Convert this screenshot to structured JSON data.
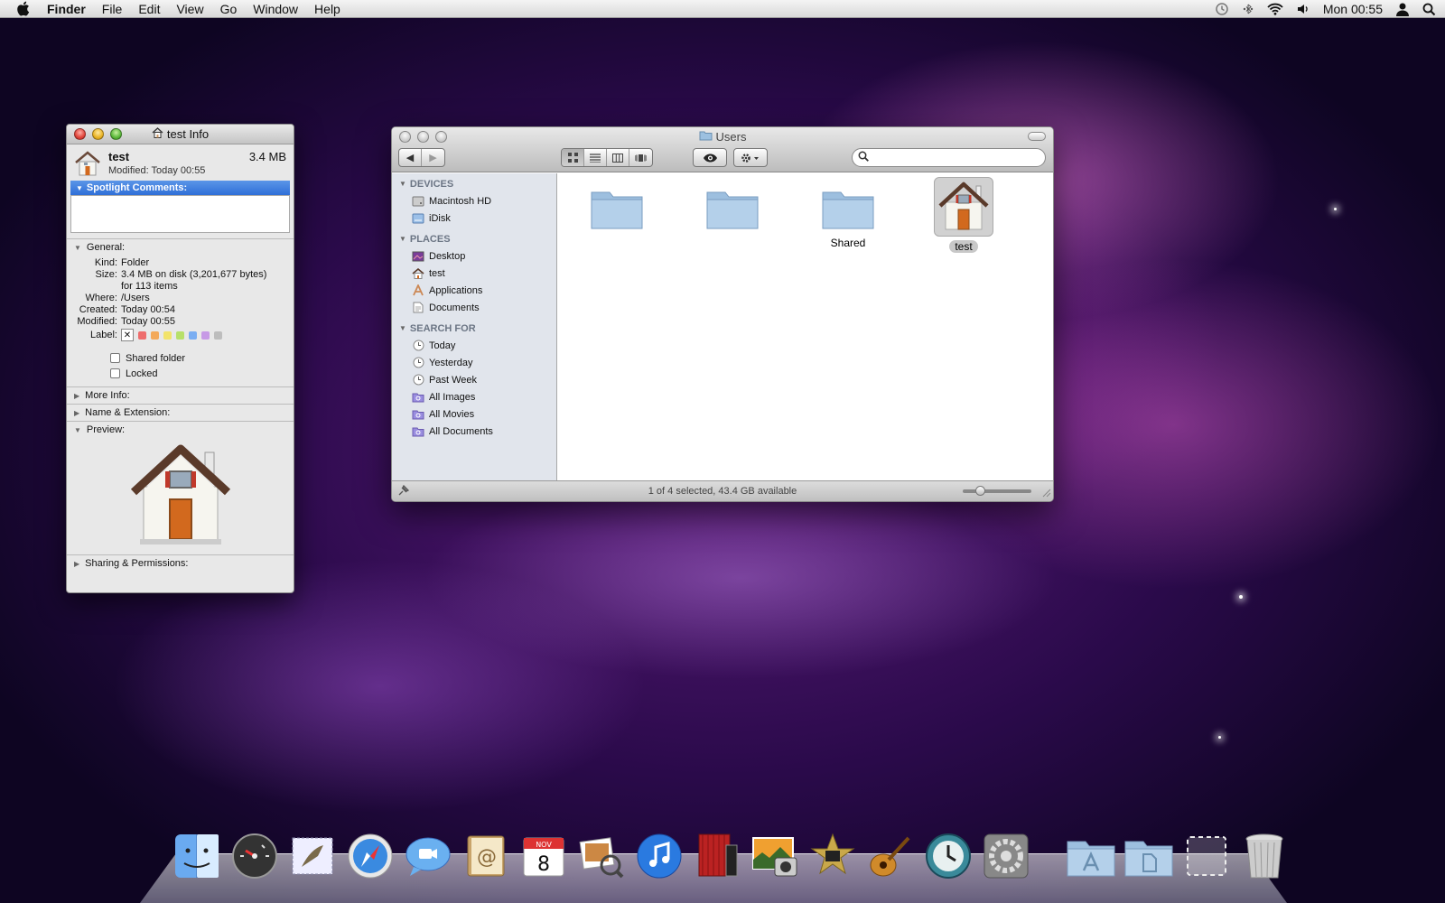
{
  "menubar": {
    "app": "Finder",
    "items": [
      "File",
      "Edit",
      "View",
      "Go",
      "Window",
      "Help"
    ],
    "clock": "Mon 00:55"
  },
  "info_window": {
    "title": "test Info",
    "name": "test",
    "size": "3.4 MB",
    "modified_line": "Modified: Today 00:55",
    "spotlight_header": "Spotlight Comments:",
    "general_header": "General:",
    "kind_label": "Kind:",
    "kind": "Folder",
    "size_label": "Size:",
    "size_detail": "3.4 MB on disk (3,201,677 bytes)",
    "size_items": "for 113 items",
    "where_label": "Where:",
    "where": "/Users",
    "created_label": "Created:",
    "created": "Today 00:54",
    "modified_label": "Modified:",
    "modified": "Today 00:55",
    "label_label": "Label:",
    "label_x": "✕",
    "shared_folder": "Shared folder",
    "locked": "Locked",
    "more_info": "More Info:",
    "name_ext": "Name & Extension:",
    "preview": "Preview:",
    "sharing": "Sharing & Permissions:",
    "label_colors": [
      "#ee6d6d",
      "#f3a95a",
      "#f2e36a",
      "#b7e06a",
      "#7aaef2",
      "#c79ae6",
      "#bdbdbd"
    ]
  },
  "finder": {
    "title": "Users",
    "sidebar": {
      "devices_header": "DEVICES",
      "devices": [
        "Macintosh HD",
        "iDisk"
      ],
      "places_header": "PLACES",
      "places": [
        "Desktop",
        "test",
        "Applications",
        "Documents"
      ],
      "search_header": "SEARCH FOR",
      "search": [
        "Today",
        "Yesterday",
        "Past Week",
        "All Images",
        "All Movies",
        "All Documents"
      ]
    },
    "items": [
      {
        "label": ""
      },
      {
        "label": ""
      },
      {
        "label": "Shared"
      },
      {
        "label": "test"
      }
    ],
    "status": "1 of 4 selected, 43.4 GB available"
  },
  "calendar_date": "8",
  "calendar_month": "NOV"
}
